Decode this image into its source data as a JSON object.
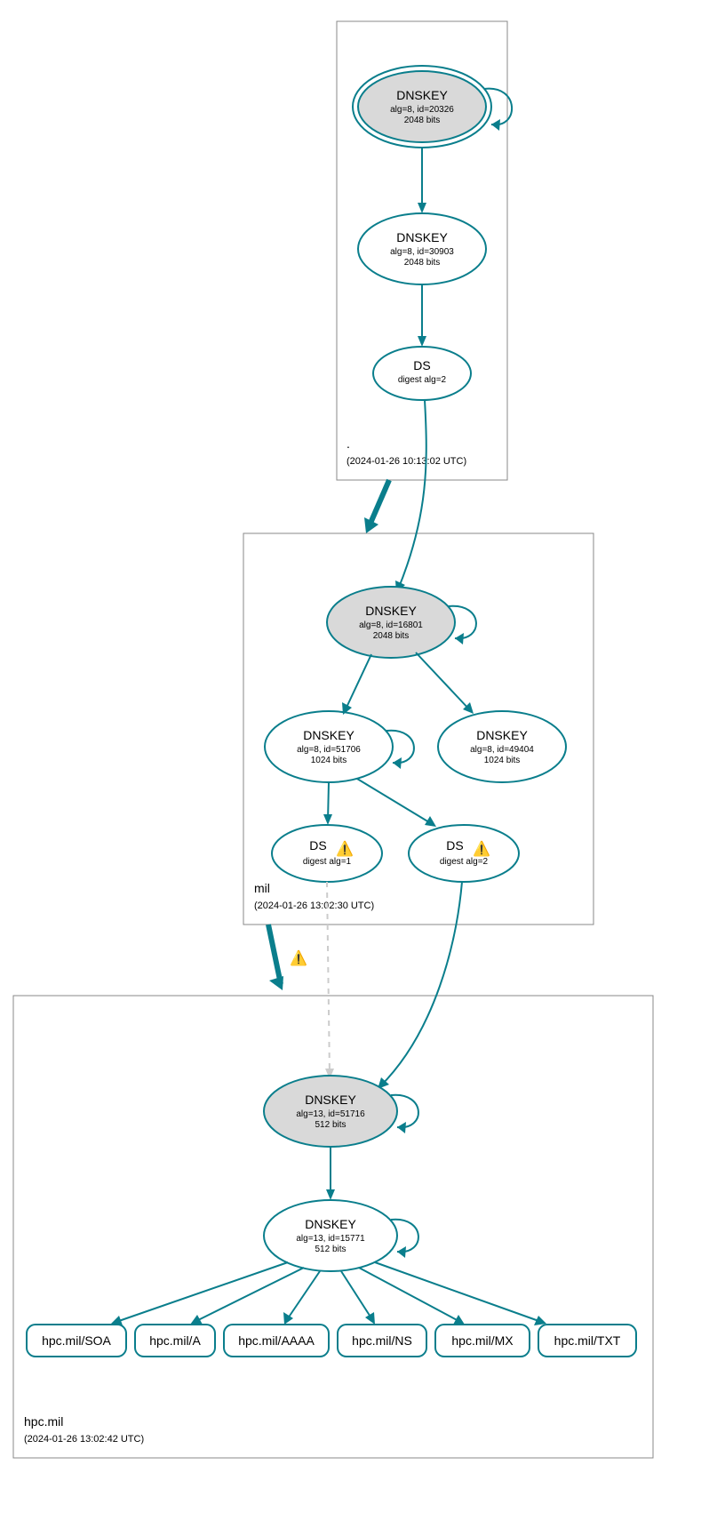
{
  "zones": {
    "root": {
      "name": ".",
      "ts": "(2024-01-26 10:13:02 UTC)"
    },
    "mil": {
      "name": "mil",
      "ts": "(2024-01-26 13:02:30 UTC)"
    },
    "hpc": {
      "name": "hpc.mil",
      "ts": "(2024-01-26 13:02:42 UTC)"
    }
  },
  "nodes": {
    "root_ksk": {
      "t": "DNSKEY",
      "s1": "alg=8, id=20326",
      "s2": "2048 bits"
    },
    "root_zsk": {
      "t": "DNSKEY",
      "s1": "alg=8, id=30903",
      "s2": "2048 bits"
    },
    "root_ds": {
      "t": "DS",
      "s1": "digest alg=2",
      "s2": ""
    },
    "mil_ksk": {
      "t": "DNSKEY",
      "s1": "alg=8, id=16801",
      "s2": "2048 bits"
    },
    "mil_zsk1": {
      "t": "DNSKEY",
      "s1": "alg=8, id=51706",
      "s2": "1024 bits"
    },
    "mil_zsk2": {
      "t": "DNSKEY",
      "s1": "alg=8, id=49404",
      "s2": "1024 bits"
    },
    "mil_ds1": {
      "t": "DS",
      "s1": "digest alg=1",
      "s2": ""
    },
    "mil_ds2": {
      "t": "DS",
      "s1": "digest alg=2",
      "s2": ""
    },
    "hpc_ksk": {
      "t": "DNSKEY",
      "s1": "alg=13, id=51716",
      "s2": "512 bits"
    },
    "hpc_zsk": {
      "t": "DNSKEY",
      "s1": "alg=13, id=15771",
      "s2": "512 bits"
    }
  },
  "rr": {
    "soa": "hpc.mil/SOA",
    "a": "hpc.mil/A",
    "aaaa": "hpc.mil/AAAA",
    "ns": "hpc.mil/NS",
    "mx": "hpc.mil/MX",
    "txt": "hpc.mil/TXT"
  },
  "warn": "⚠️"
}
